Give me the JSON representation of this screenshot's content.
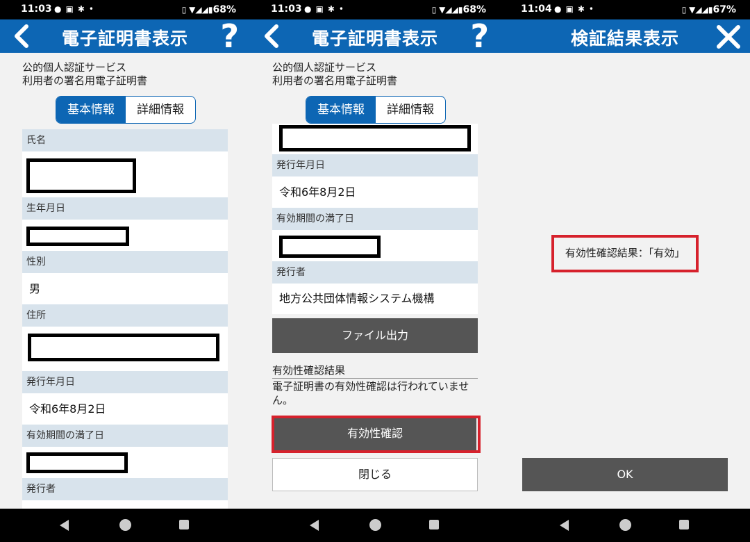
{
  "status": {
    "s1": {
      "time": "11:03",
      "battery": "68%"
    },
    "s2": {
      "time": "11:03",
      "battery": "68%"
    },
    "s3": {
      "time": "11:04",
      "battery": "67%"
    },
    "left_icons": [
      "message-icon",
      "sim-icon",
      "gear-icon",
      "dot-icon"
    ],
    "right_icons": [
      "vibrate-icon",
      "wifi-icon",
      "signal-icon",
      "signal-icon",
      "battery-icon"
    ]
  },
  "s1": {
    "title": "電子証明書表示",
    "subtitle_line1": "公的個人認証サービス",
    "subtitle_line2": "利用者の署名用電子証明書",
    "tab_basic": "基本情報",
    "tab_detail": "詳細情報",
    "fields": {
      "name_label": "氏名",
      "birth_label": "生年月日",
      "gender_label": "性別",
      "gender_value": "男",
      "address_label": "住所",
      "issue_label": "発行年月日",
      "issue_value": "令和6年8月2日",
      "expiry_label": "有効期間の満了日",
      "issuer_label": "発行者"
    }
  },
  "s2": {
    "title": "電子証明書表示",
    "subtitle_line1": "公的個人認証サービス",
    "subtitle_line2": "利用者の署名用電子証明書",
    "tab_basic": "基本情報",
    "tab_detail": "詳細情報",
    "fields": {
      "issue_label": "発行年月日",
      "issue_value": "令和6年8月2日",
      "expiry_label": "有効期間の満了日",
      "issuer_label": "発行者",
      "issuer_value": "地方公共団体情報システム機構"
    },
    "file_output_button": "ファイル出力",
    "validity_heading": "有効性確認結果",
    "validity_message": "電子証明書の有効性確認は行われていません。",
    "validity_check_button": "有効性確認",
    "close_button": "閉じる"
  },
  "s3": {
    "title": "検証結果表示",
    "result_text": "有効性確認結果：「有効」",
    "ok_button": "OK"
  },
  "colors": {
    "header_blue": "#0d66b4",
    "label_bg": "#d8e3ec",
    "button_dark": "#555555",
    "highlight_red": "#d6212c",
    "screen_bg": "#f2f2f2"
  }
}
